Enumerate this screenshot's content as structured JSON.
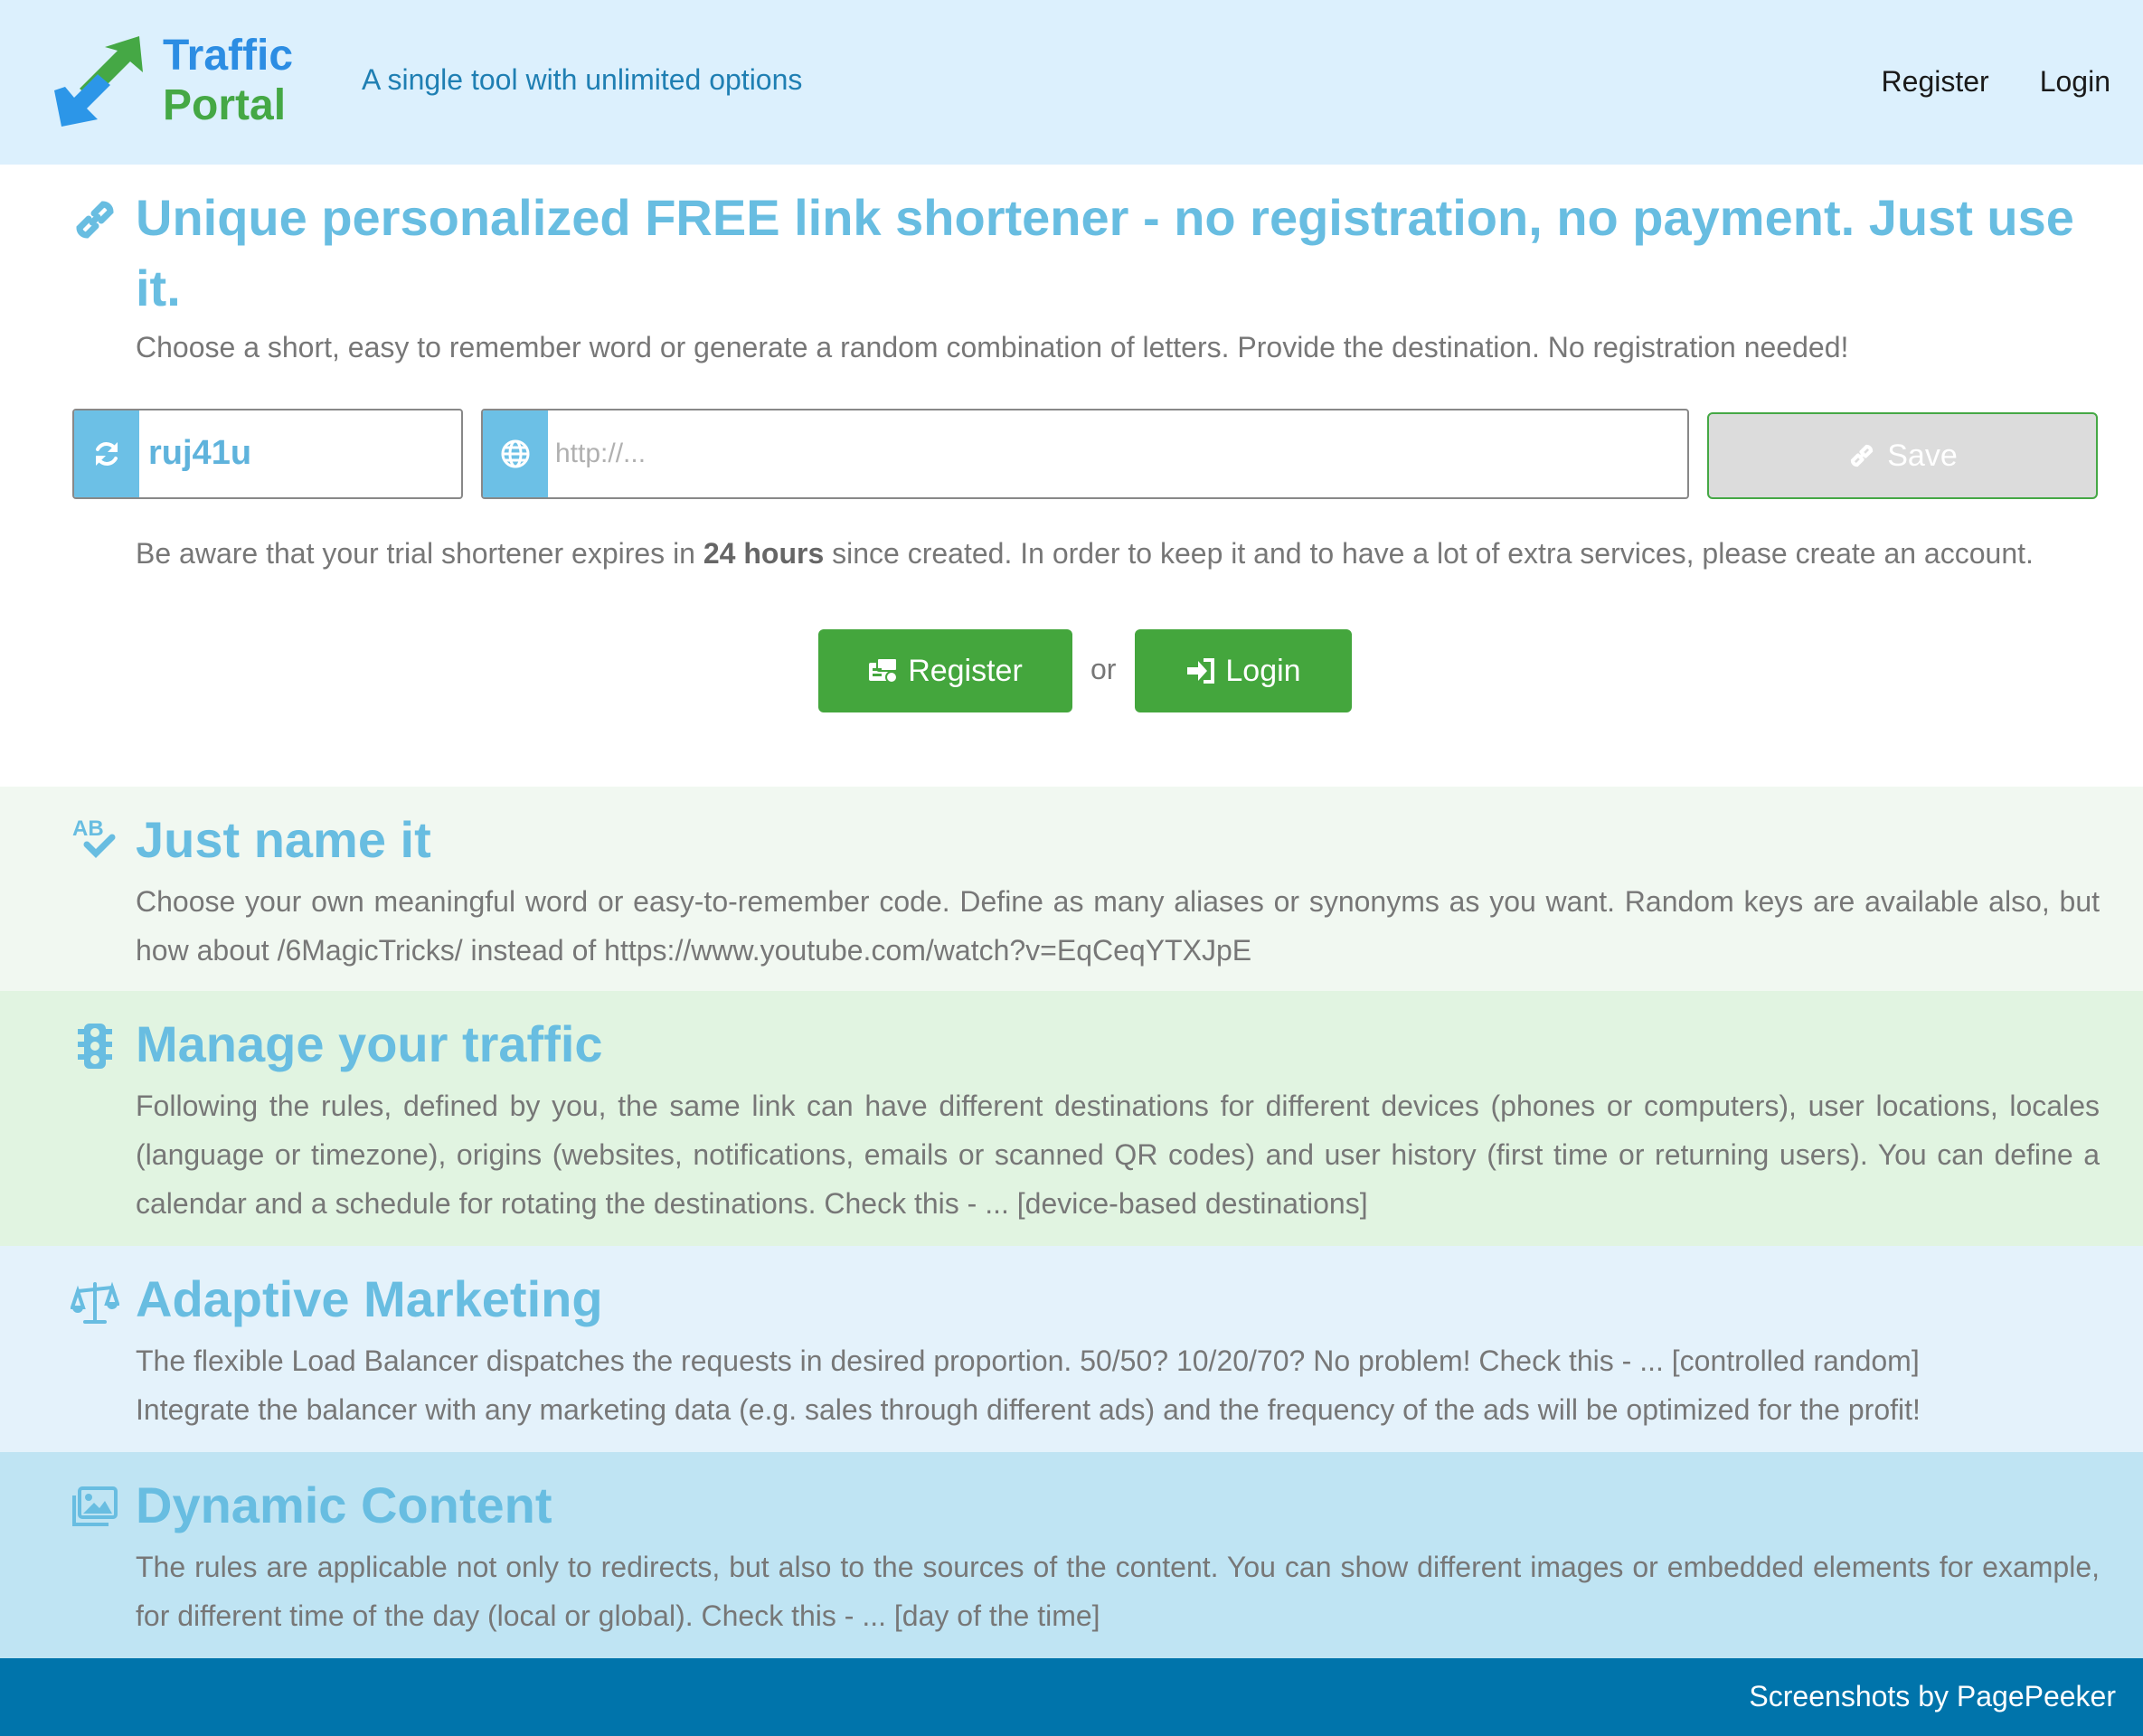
{
  "header": {
    "logo_line1": "Traffic",
    "logo_line2": "Portal",
    "tagline": "A single tool with unlimited options",
    "nav": {
      "register": "Register",
      "login": "Login"
    }
  },
  "hero": {
    "title": "Unique personalized FREE link shortener - no registration, no payment. Just use it.",
    "subtitle": "Choose a short, easy to remember word or generate a random combination of letters. Provide the destination. No registration needed!",
    "code_value": "ruj41u",
    "url_placeholder": "http://...",
    "save_label": "Save",
    "warning_pre": "Be aware that your trial shortener expires in ",
    "warning_bold": "24 hours",
    "warning_post": " since created. In order to keep it and to have a lot of extra services, please create an account.",
    "register_label": "Register",
    "or_text": "or",
    "login_label": "Login"
  },
  "features": [
    {
      "title": "Just name it",
      "icon": "spellcheck-icon",
      "text": "Choose your own meaningful word or easy-to-remember code. Define as many aliases or synonyms as you want. Random keys are available also, but how about /6MagicTricks/ instead of https://www.youtube.com/watch?v=EqCeqYTXJpE"
    },
    {
      "title": "Manage your traffic",
      "icon": "traffic-light-icon",
      "text": "Following the rules, defined by you, the same link can have different destinations for different devices (phones or computers), user locations, locales (language or timezone), origins (websites, notifications, emails or scanned QR codes) and user history (first time or returning users). You can define a calendar and a schedule for rotating the destinations. Check this - ... [device-based destinations]"
    },
    {
      "title": "Adaptive Marketing",
      "icon": "balance-scale-icon",
      "line1": "The flexible Load Balancer dispatches the requests in desired proportion. 50/50? 10/20/70? No problem! Check this - ... [controlled random]",
      "line2": "Integrate the balancer with any marketing data (e.g. sales through different ads) and the frequency of the ads will be optimized for the profit!"
    },
    {
      "title": "Dynamic Content",
      "icon": "images-icon",
      "text": "The rules are applicable not only to redirects, but also to the sources of the content. You can show different images or embedded elements for example, for different time of the day (local or global). Check this - ... [day of the time]"
    }
  ],
  "footer": {
    "text": "Screenshots by PagePeeker"
  },
  "colors": {
    "header_bg": "#dcf0fd",
    "accent_blue": "#68bde1",
    "green": "#44a63d",
    "footer_bg": "#0074ab"
  }
}
